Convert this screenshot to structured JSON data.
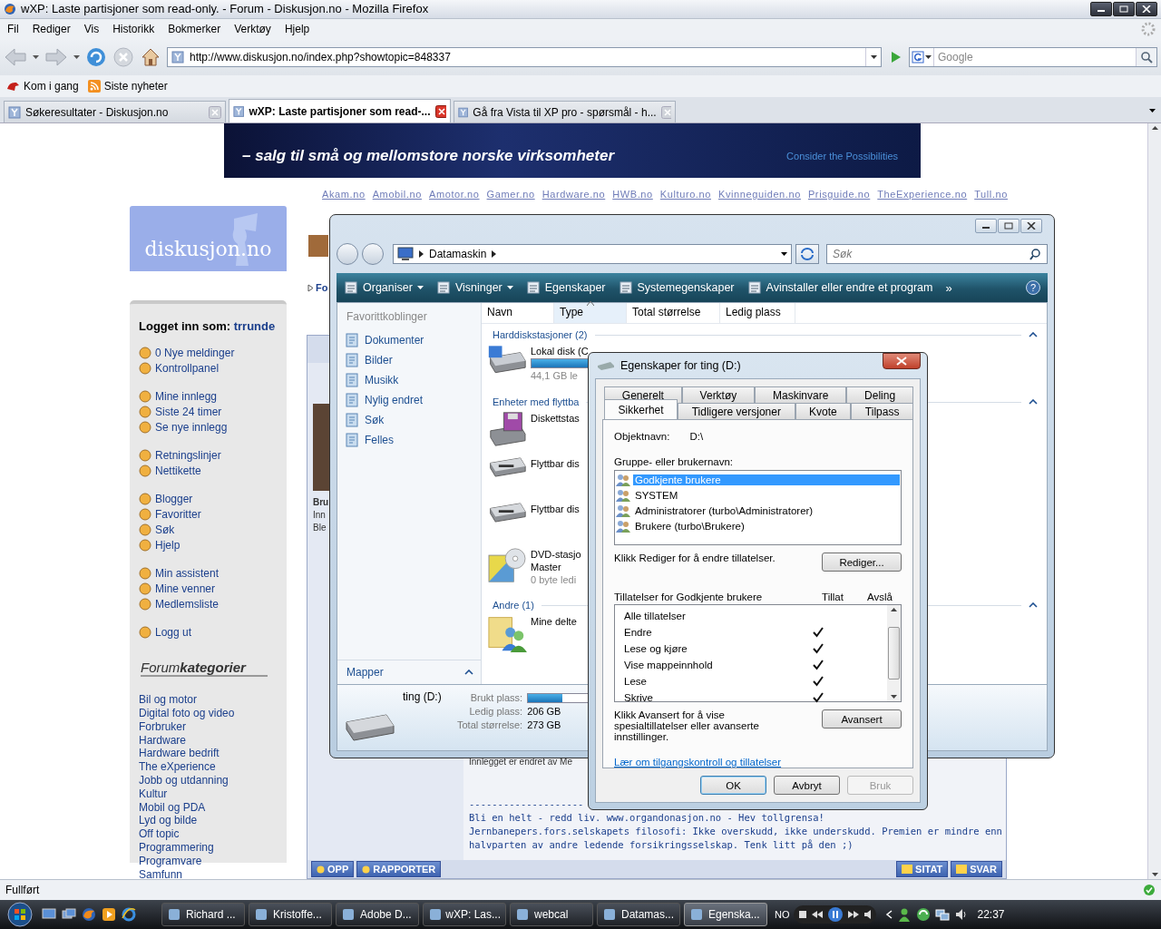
{
  "browser": {
    "title": "wXP: Laste partisjoner som read-only. - Forum - Diskusjon.no - Mozilla Firefox",
    "menu": [
      "Fil",
      "Rediger",
      "Vis",
      "Historikk",
      "Bokmerker",
      "Verktøy",
      "Hjelp"
    ],
    "url": "http://www.diskusjon.no/index.php?showtopic=848337",
    "search_placeholder": "Google",
    "bookmarks": [
      "Kom i gang",
      "Siste nyheter"
    ],
    "tabs": [
      {
        "label": "Søkeresultater - Diskusjon.no",
        "selected": false
      },
      {
        "label": "wXP: Laste partisjoner som read-...",
        "selected": true
      },
      {
        "label": "Gå fra Vista til XP pro - spørsmål - h...",
        "selected": false
      }
    ],
    "status": "Fullført"
  },
  "page": {
    "banner": {
      "headline": "– salg til små og mellomstore norske virksomheter",
      "tagline": "Consider the Possibilities"
    },
    "network_links": [
      "Akam.no",
      "Amobil.no",
      "Amotor.no",
      "Gamer.no",
      "Hardware.no",
      "HWB.no",
      "Kulturo.no",
      "Kvinneguiden.no",
      "Prisguide.no",
      "TheExperience.no",
      "Tull.no"
    ],
    "sidebar": {
      "logo": "diskusjon.no",
      "logged_in_label": "Logget inn som:",
      "user": "trrunde",
      "groups": [
        [
          "0 Nye meldinger",
          "Kontrollpanel"
        ],
        [
          "Mine innlegg",
          "Siste 24 timer",
          "Se nye innlegg"
        ],
        [
          "Retningslinjer",
          "Nettikette"
        ],
        [
          "Blogger",
          "Favoritter",
          "Søk",
          "Hjelp"
        ],
        [
          "Min assistent",
          "Mine venner",
          "Medlemsliste"
        ],
        [
          "Logg ut"
        ]
      ],
      "categories_title": "Forum**kategorier**",
      "categories": [
        "Bil og motor",
        "Digital foto og video",
        "Forbruker",
        "Hardware",
        "Hardware bedrift",
        "The eXperience",
        "Jobb og utdanning",
        "Kultur",
        "Mobil og PDA",
        "Lyd og bilde",
        "Off topic",
        "Programmering",
        "Programvare",
        "Samfunn"
      ]
    },
    "breadcrumb": "Fo",
    "post": {
      "side_lines": [
        "Bru",
        "Inn",
        "Ble"
      ],
      "edited": "Innlegget er endret av Me",
      "separator": "--------------------",
      "signature": [
        "Bli en helt - redd liv. www.organdonasjon.no - Hev tollgrensa!",
        "Jernbanepers.fors.selskapets filosofi: Ikke overskudd, ikke underskudd. Premien er mindre enn halvparten av andre ledende forsikringsselskap. Tenk litt på den ;)"
      ],
      "left_buttons": [
        "OPP",
        "RAPPORTER"
      ],
      "right_buttons": [
        "SITAT",
        "SVAR"
      ]
    }
  },
  "explorer": {
    "breadcrumb": "Datamaskin",
    "search_placeholder": "Søk",
    "toolbar": [
      {
        "label": "Organiser",
        "dropdown": true
      },
      {
        "label": "Visninger",
        "dropdown": true
      },
      {
        "label": "Egenskaper",
        "dropdown": false
      },
      {
        "label": "Systemegenskaper",
        "dropdown": false
      },
      {
        "label": "Avinstaller eller endre et program",
        "dropdown": false
      }
    ],
    "more": "»",
    "help": "?",
    "favorites_title": "Favorittkoblinger",
    "favorites": [
      "Dokumenter",
      "Bilder",
      "Musikk",
      "Nylig endret",
      "Søk",
      "Felles"
    ],
    "folders": "Mapper",
    "columns": [
      {
        "label": "Navn",
        "sorted": false
      },
      {
        "label": "Type",
        "sorted": true
      },
      {
        "label": "Total størrelse",
        "sorted": false
      },
      {
        "label": "Ledig plass",
        "sorted": false
      }
    ],
    "groups": [
      {
        "title": "Harddiskstasjoner (2)",
        "items": [
          {
            "kind": "disk",
            "name": "Lokal disk (C",
            "lines": [
              "44,1 GB le"
            ],
            "level": 0.85
          }
        ]
      },
      {
        "title": "Enheter med flyttba",
        "items": [
          {
            "kind": "floppy",
            "name": "Diskettstas"
          },
          {
            "kind": "removable",
            "name": "Flyttbar dis"
          },
          {
            "kind": "removable",
            "name": "Flyttbar dis"
          },
          {
            "kind": "dvd",
            "name": "DVD-stasjo",
            "lines": [
              "Master",
              "0 byte ledi"
            ]
          }
        ]
      },
      {
        "title": "Andre (1)",
        "items": [
          {
            "kind": "shared",
            "name": "Mine delte"
          }
        ]
      }
    ],
    "details": {
      "name": "ting (D:)",
      "used_label": "Brukt plass:",
      "level": 0.25,
      "rows": [
        {
          "label": "Ledig plass:",
          "value": "206 GB"
        },
        {
          "label": "Total størrelse:",
          "value": "273 GB"
        }
      ]
    }
  },
  "dialog": {
    "title": "Egenskaper for ting (D:)",
    "tab_rows": [
      [
        {
          "label": "Generelt",
          "selected": false
        },
        {
          "label": "Verktøy",
          "selected": false
        },
        {
          "label": "Maskinvare",
          "selected": false
        },
        {
          "label": "Deling",
          "selected": false
        }
      ],
      [
        {
          "label": "Sikkerhet",
          "selected": true
        },
        {
          "label": "Tidligere versjoner",
          "selected": false
        },
        {
          "label": "Kvote",
          "selected": false
        },
        {
          "label": "Tilpass",
          "selected": false
        }
      ]
    ],
    "object_label": "Objektnavn:",
    "object_value": "D:\\",
    "groups_label": "Gruppe- eller brukernavn:",
    "principals": [
      {
        "label": "Godkjente brukere",
        "selected": true
      },
      {
        "label": "SYSTEM",
        "selected": false
      },
      {
        "label": "Administratorer (turbo\\Administratorer)",
        "selected": false
      },
      {
        "label": "Brukere (turbo\\Brukere)",
        "selected": false
      }
    ],
    "edit_hint": "Klikk Rediger for å endre tillatelser.",
    "edit_button": "Rediger...",
    "perm_title": "Tillatelser for Godkjente brukere",
    "allow_header": "Tillat",
    "deny_header": "Avslå",
    "permissions": [
      {
        "label": "Alle tillatelser",
        "allow": false,
        "deny": false
      },
      {
        "label": "Endre",
        "allow": true,
        "deny": false
      },
      {
        "label": "Lese og kjøre",
        "allow": true,
        "deny": false
      },
      {
        "label": "Vise mappeinnhold",
        "allow": true,
        "deny": false
      },
      {
        "label": "Lese",
        "allow": true,
        "deny": false
      },
      {
        "label": "Skrive",
        "allow": true,
        "deny": false
      }
    ],
    "advanced_hint": "Klikk Avansert for å vise spesialtillatelser eller avanserte innstillinger.",
    "advanced_button": "Avansert",
    "link": "Lær om tilgangskontroll og tillatelser",
    "buttons": [
      {
        "label": "OK",
        "disabled": false
      },
      {
        "label": "Avbryt",
        "disabled": false
      },
      {
        "label": "Bruk",
        "disabled": true
      }
    ]
  },
  "taskbar": {
    "tasks": [
      {
        "label": "Richard ...",
        "selected": false
      },
      {
        "label": "Kristoffe...",
        "selected": false
      },
      {
        "label": "Adobe D...",
        "selected": false
      },
      {
        "label": "wXP: Las...",
        "selected": false
      },
      {
        "label": "webcal",
        "selected": false
      },
      {
        "label": "Datamas...",
        "selected": false
      },
      {
        "label": "Egenska...",
        "selected": true
      }
    ],
    "language": "NO",
    "clock": "22:37"
  }
}
